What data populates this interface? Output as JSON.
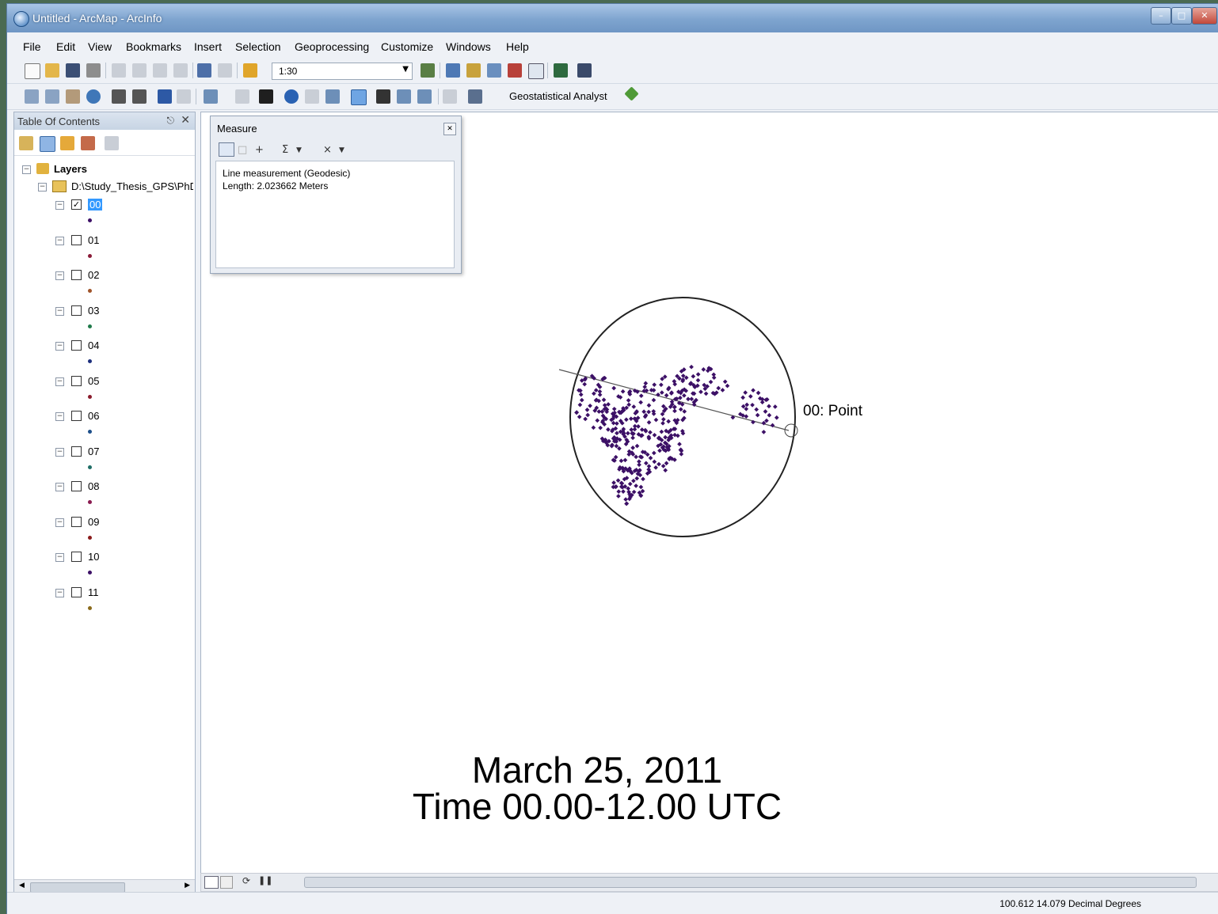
{
  "window": {
    "title": "Untitled - ArcMap - ArcInfo"
  },
  "menu": [
    "File",
    "Edit",
    "View",
    "Bookmarks",
    "Insert",
    "Selection",
    "Geoprocessing",
    "Customize",
    "Windows",
    "Help"
  ],
  "toolbar": {
    "scale": "1:30",
    "geostat_label": "Geostatistical Analyst"
  },
  "toc": {
    "title": "Table Of Contents",
    "root": "Layers",
    "folder": "D:\\Study_Thesis_GPS\\PhD",
    "layers": [
      {
        "name": "00",
        "checked": true,
        "color": "#3c1066"
      },
      {
        "name": "01",
        "checked": false,
        "color": "#8a1b38"
      },
      {
        "name": "02",
        "checked": false,
        "color": "#a0542a"
      },
      {
        "name": "03",
        "checked": false,
        "color": "#1f7a4a"
      },
      {
        "name": "04",
        "checked": false,
        "color": "#1d2f7d"
      },
      {
        "name": "05",
        "checked": false,
        "color": "#8a1b2c"
      },
      {
        "name": "06",
        "checked": false,
        "color": "#1d4f8a"
      },
      {
        "name": "07",
        "checked": false,
        "color": "#1f6e66"
      },
      {
        "name": "08",
        "checked": false,
        "color": "#8a1b50"
      },
      {
        "name": "09",
        "checked": false,
        "color": "#8a1b1b"
      },
      {
        "name": "10",
        "checked": false,
        "color": "#3c1066"
      },
      {
        "name": "11",
        "checked": false,
        "color": "#8a6a1b"
      }
    ]
  },
  "measure": {
    "title": "Measure",
    "line1": "Line measurement (Geodesic)",
    "line2": "Length: 2.023662 Meters"
  },
  "map": {
    "point_label": "00: Point",
    "date": "March 25, 2011",
    "time": "Time 00.00-12.00 UTC",
    "point_color": "#3c1066"
  },
  "status": {
    "coords": "100.612  14.079 Decimal Degrees"
  }
}
